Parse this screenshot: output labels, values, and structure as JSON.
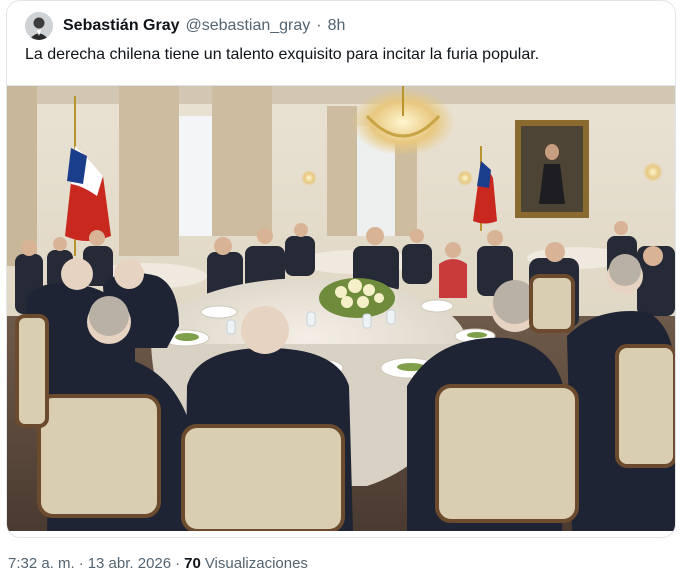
{
  "post": {
    "author_name": "Sebastián Gray",
    "handle": "@sebastian_gray",
    "separator": "·",
    "time_ago": "8h",
    "text": "La derecha chilena tiene un talento exquisito para incitar la furia popular.",
    "image_icon": "photo-banquet"
  },
  "footer": {
    "time": "7:32 a. m.",
    "separator": "·",
    "date": "13 abr. 2026",
    "separator2": "·",
    "views_count": "70",
    "views_label": "Visualizaciones"
  },
  "colors": {
    "text_primary": "#0f1419",
    "text_secondary": "#536471",
    "border": "#e1e4e8"
  }
}
